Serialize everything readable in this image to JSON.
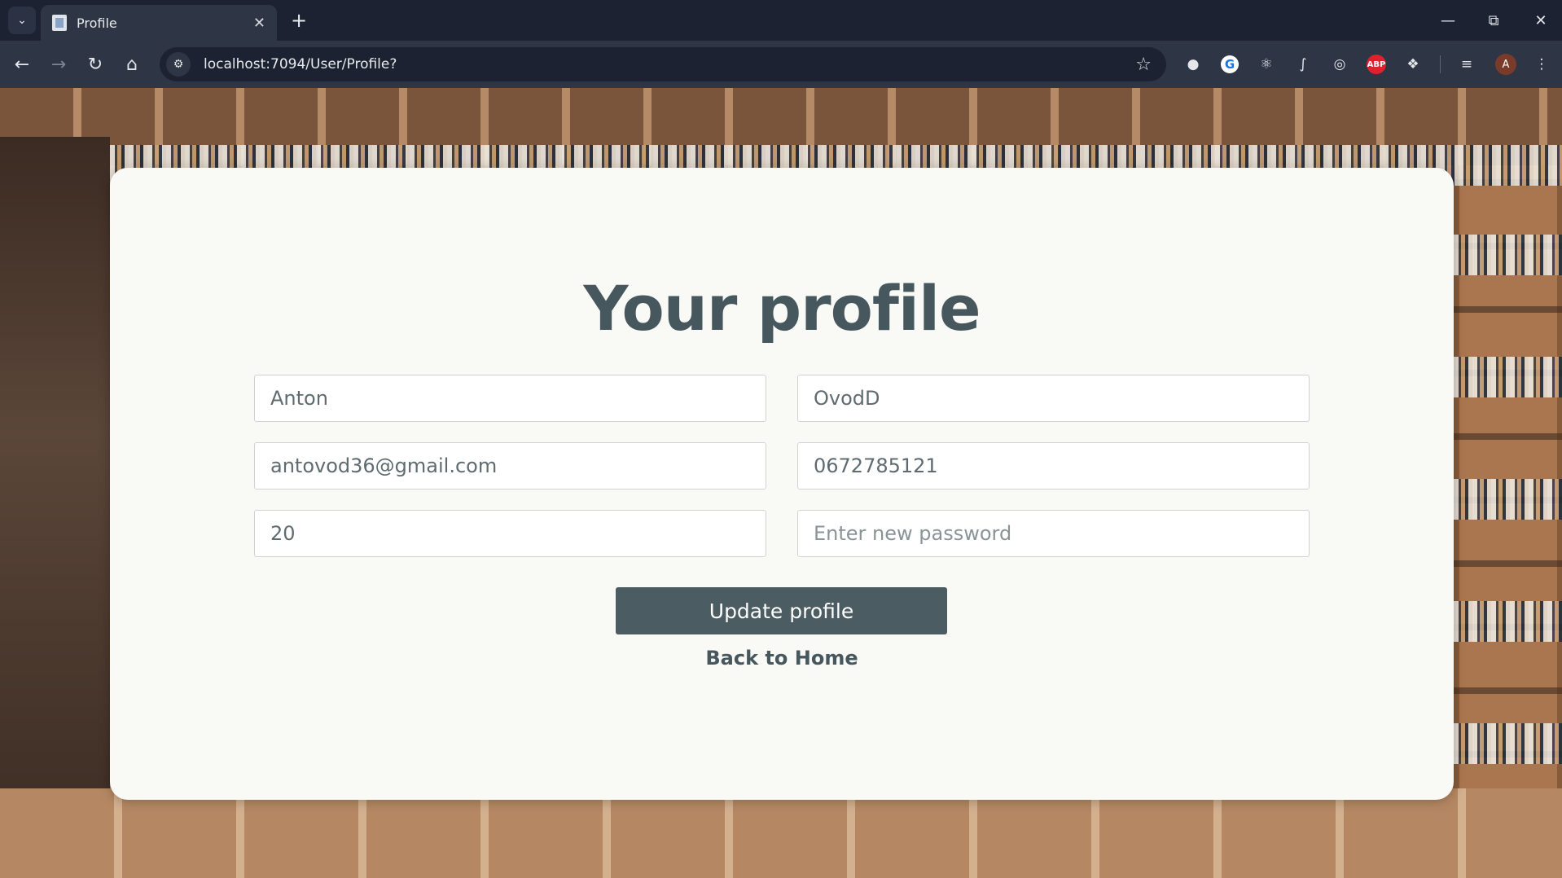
{
  "browser": {
    "tab_title": "Profile",
    "url": "localhost:7094/User/Profile?",
    "avatar_letter": "A",
    "abp_label": "ABP",
    "icons": [
      "tab-list-icon",
      "page-icon",
      "close-icon",
      "plus-icon",
      "minimize-icon",
      "restore-icon",
      "window-close-icon",
      "back-icon",
      "forward-icon",
      "reload-icon",
      "home-icon",
      "site-info-icon",
      "star-icon",
      "extensions-icon",
      "reading-list-icon",
      "menu-icon"
    ]
  },
  "page": {
    "heading": "Your profile",
    "fields": {
      "first_name": "Anton",
      "last_name": "OvodD",
      "email": "antovod36@gmail.com",
      "phone": "0672785121",
      "age": "20",
      "password_placeholder": "Enter new password"
    },
    "update_label": "Update profile",
    "back_label": "Back to Home"
  },
  "colors": {
    "card_bg": "#f9f9f6",
    "heading": "#47575e",
    "button_bg": "#4b5c62",
    "chrome_dark": "#1c2231",
    "chrome_toolbar": "#2e3545"
  }
}
